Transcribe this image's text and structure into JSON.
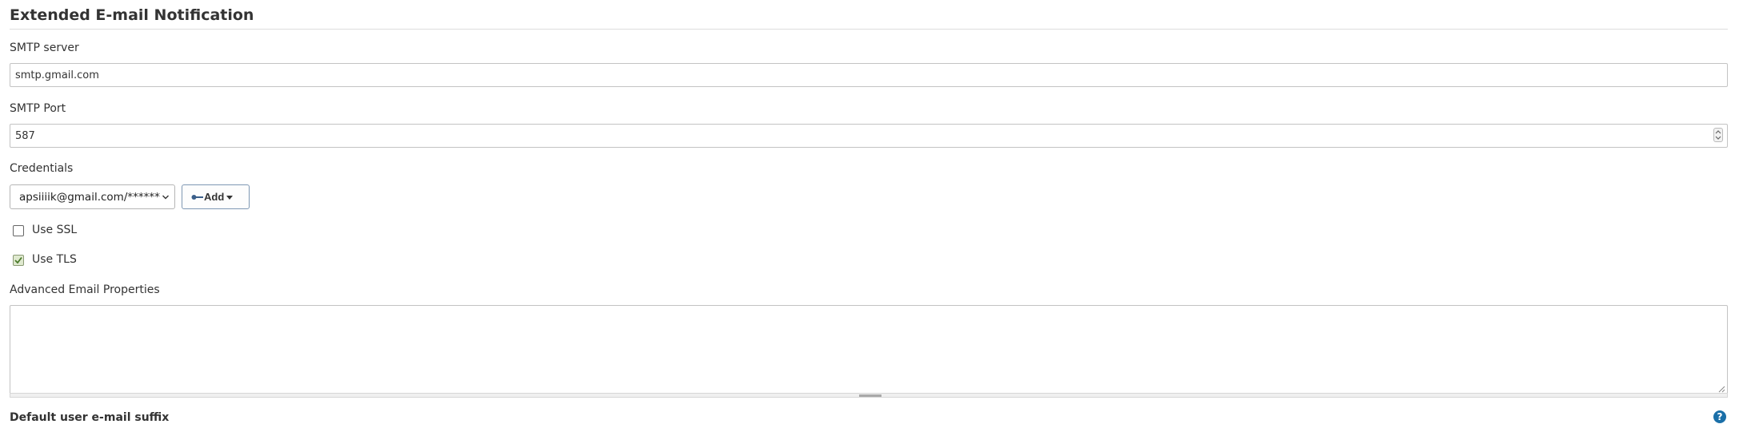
{
  "section": {
    "title": "Extended E-mail Notification"
  },
  "smtp_server": {
    "label": "SMTP server",
    "value": "smtp.gmail.com"
  },
  "smtp_port": {
    "label": "SMTP Port",
    "value": "587"
  },
  "credentials": {
    "label": "Credentials",
    "selected": "apsiiiik@gmail.com/******",
    "add_label": "Add"
  },
  "use_ssl": {
    "label": "Use SSL",
    "checked": false
  },
  "use_tls": {
    "label": "Use TLS",
    "checked": true
  },
  "advanced_props": {
    "label": "Advanced Email Properties",
    "value": ""
  },
  "default_suffix": {
    "label": "Default user e-mail suffix"
  },
  "icons": {
    "key": "key-icon",
    "caret": "caret-down-icon",
    "check": "checkmark-icon",
    "help": "help-icon"
  },
  "colors": {
    "check_green": "#4a7a2a",
    "help_blue": "#1a6fa8"
  }
}
